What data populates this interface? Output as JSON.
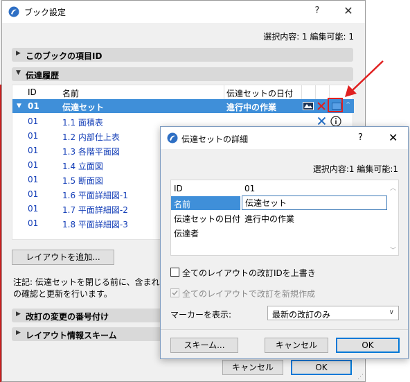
{
  "book_settings": {
    "title": "ブック設定",
    "help": "?",
    "close": "✕",
    "selection_info": "選択内容: 1 編集可能: 1",
    "sections": {
      "book_item_id": "このブックの項目ID",
      "transmittal_history": "伝達履歴",
      "revision_numbering": "改訂の変更の番号付け",
      "layout_info_scheme": "レイアウト情報スキーム"
    },
    "table": {
      "headers": {
        "id": "ID",
        "name": "名前",
        "transmittal_date": "伝達セットの日付"
      },
      "selected_row": {
        "id": "01",
        "name": "伝達セット",
        "date": "進行中の作業"
      },
      "rows": [
        {
          "id": "01",
          "name": "1.1 面積表"
        },
        {
          "id": "01",
          "name": "1.2 内部仕上表"
        },
        {
          "id": "01",
          "name": "1.3 各階平面図"
        },
        {
          "id": "01",
          "name": "1.4 立面図"
        },
        {
          "id": "01",
          "name": "1.5 断面図"
        },
        {
          "id": "01",
          "name": "1.6 平面詳細図-1"
        },
        {
          "id": "01",
          "name": "1.7 平面詳細図-2"
        },
        {
          "id": "01",
          "name": "1.8 平面詳細図-3"
        }
      ]
    },
    "add_layout_button": "レイアウトを追加...",
    "note_line1": "注記: 伝達セットを閉じる前に、含まれる全て",
    "note_line2": "の確認と更新を行います。",
    "cancel_button": "キャンセル",
    "ok_button": "OK"
  },
  "detail_dialog": {
    "title": "伝達セットの詳細",
    "help": "?",
    "close": "✕",
    "selection_info": "選択内容:1 編集可能:1",
    "props": {
      "id_label": "ID",
      "id_value": "01",
      "name_label": "名前",
      "name_value": "伝達セット",
      "date_label": "伝達セットの日付",
      "date_value": "進行中の作業",
      "sender_label": "伝達者"
    },
    "overwrite_revision_id": "全てのレイアウトの改訂IDを上書き",
    "create_new_revision": "全てのレイアウトで改訂を新規作成",
    "marker_label": "マーカーを表示:",
    "marker_value": "最新の改訂のみ",
    "scheme_button": "スキーム...",
    "cancel_button": "キャンセル",
    "ok_button": "OK"
  },
  "colors": {
    "selection_blue": "#3f8fd9",
    "link_blue": "#1640b8",
    "annotation_red": "#e02020"
  }
}
